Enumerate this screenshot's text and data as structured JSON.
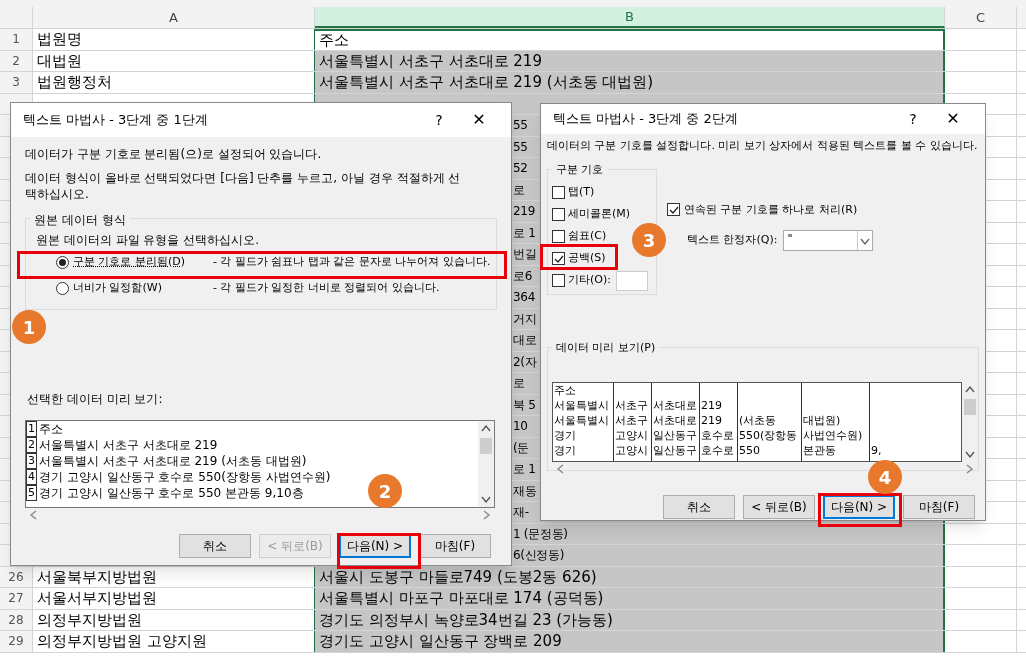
{
  "sheet": {
    "columns": [
      {
        "label": "A",
        "selected": false
      },
      {
        "label": "B",
        "selected": true
      },
      {
        "label": "C",
        "selected": false
      }
    ],
    "rows": [
      {
        "kind": "full",
        "num": "1",
        "a": "법원명",
        "b": "주소",
        "selected": false
      },
      {
        "kind": "full",
        "num": "2",
        "a": "대법원",
        "b": "서울특별시 서초구 서초대로 219",
        "selected": true
      },
      {
        "kind": "full",
        "num": "3",
        "a": "법원행정처",
        "b": "서울특별시 서초구 서초대로 219 (서초동 대법원)",
        "selected": true
      },
      {
        "kind": "covered",
        "selected": true
      },
      {
        "kind": "fragment",
        "b": "55",
        "selected": true
      },
      {
        "kind": "fragment",
        "b": "55",
        "selected": true
      },
      {
        "kind": "fragment",
        "b": "52",
        "selected": true
      },
      {
        "kind": "fragment",
        "b": "로 ",
        "selected": true
      },
      {
        "kind": "fragment",
        "b": "219",
        "selected": true
      },
      {
        "kind": "fragment",
        "b": "로 1",
        "selected": true
      },
      {
        "kind": "fragment",
        "b": "번길",
        "selected": true
      },
      {
        "kind": "fragment",
        "b": "로6",
        "selected": true
      },
      {
        "kind": "fragment",
        "b": "364",
        "selected": true
      },
      {
        "kind": "fragment",
        "b": "거지",
        "selected": true
      },
      {
        "kind": "fragment",
        "b": "대로",
        "selected": true
      },
      {
        "kind": "fragment",
        "b": "2(자",
        "selected": true
      },
      {
        "kind": "fragment",
        "b": "로 ",
        "selected": true
      },
      {
        "kind": "fragment",
        "b": "북 5",
        "selected": true
      },
      {
        "kind": "fragment",
        "b": " 10",
        "selected": true
      },
      {
        "kind": "fragment",
        "b": "(둔",
        "selected": true
      },
      {
        "kind": "fragment",
        "b": "로 1",
        "selected": true
      },
      {
        "kind": "fragment",
        "b": "재동",
        "selected": true
      },
      {
        "kind": "fragment",
        "b": "재-",
        "selected": true
      },
      {
        "kind": "fragment",
        "b": "1 (문정동)",
        "selected": true
      },
      {
        "kind": "fragment",
        "b": "6(신정동)",
        "selected": true
      },
      {
        "kind": "full",
        "num": "26",
        "a": "서울북부지방법원",
        "b": "서울시 도봉구 마들로749 (도봉2동 626)",
        "selected": true
      },
      {
        "kind": "full",
        "num": "27",
        "a": "서울서부지방법원",
        "b": "서울특별시 마포구 마포대로 174 (공덕동)",
        "selected": true
      },
      {
        "kind": "full",
        "num": "28",
        "a": "의정부지방법원",
        "b": "경기도 의정부시 녹양로34번길 23 (가능동)",
        "selected": true
      },
      {
        "kind": "full",
        "num": "29",
        "a": "의정부지방법원 고양지원",
        "b": "경기도 고양시 일산동구 장백로 209",
        "selected": true
      }
    ]
  },
  "wizard_step1": {
    "title": "텍스트 마법사 - 3단계 중 1단계",
    "help": "?",
    "close": "✕",
    "intro": "데이터가 구분 기호로 분리됨(으)로 설정되어 있습니다.",
    "instructions": "데이터 형식이 올바로 선택되었다면 [다음] 단추를 누르고, 아닐 경우 적절하게 선택하십시오.",
    "group_label": "원본 데이터 형식",
    "group_prompt": "원본 데이터의 파일 유형을 선택하십시오.",
    "options": [
      {
        "label": "구분 기호로 분리됨(D)",
        "description": "- 각 필드가 쉼표나 탭과 같은 문자로 나누어져 있습니다.",
        "selected": true
      },
      {
        "label": "너비가 일정함(W)",
        "description": "- 각 필드가 일정한 너비로 정렬되어 있습니다.",
        "selected": false
      }
    ],
    "preview_label": "선택한 데이터 미리 보기:",
    "preview_lines": [
      {
        "num": "1",
        "text": "주소"
      },
      {
        "num": "2",
        "text": "서울특별시 서초구 서초대로 219"
      },
      {
        "num": "3",
        "text": "서울특별시 서초구 서초대로 219 (서초동 대법원)"
      },
      {
        "num": "4",
        "text": "경기 고양시 일산동구 호수로 550(장항동 사법연수원)"
      },
      {
        "num": "5",
        "text": "경기 고양시 일산동구 호수로 550 본관동 9,10층"
      }
    ],
    "buttons": [
      {
        "label": "취소",
        "disabled": false,
        "focused": false
      },
      {
        "label": "< 뒤로(B)",
        "disabled": true,
        "focused": false
      },
      {
        "label": "다음(N) >",
        "disabled": false,
        "focused": true
      },
      {
        "label": "마침(F)",
        "disabled": false,
        "focused": false
      }
    ]
  },
  "wizard_step2": {
    "title": "텍스트 마법사 - 3단계 중 2단계",
    "help": "?",
    "close": "✕",
    "intro": "데이터의 구분 기호를 설정합니다. 미리 보기 상자에서 적용된 텍스트를 볼 수 있습니다.",
    "delimiter_label": "구분 기호",
    "delimiters": [
      {
        "label": "탭(T)",
        "checked": false
      },
      {
        "label": "세미콜론(M)",
        "checked": false
      },
      {
        "label": "쉼표(C)",
        "checked": false
      },
      {
        "label": "공백(S)",
        "checked": true
      },
      {
        "label": "기타(O):",
        "checked": false
      }
    ],
    "consecutive": {
      "label": "연속된 구분 기호를 하나로 처리(R)",
      "checked": true
    },
    "qualifier_label": "텍스트 한정자(Q):",
    "qualifier_value": "\"",
    "preview_label": "데이터 미리 보기(P)",
    "preview_rows": [
      [
        "주소"
      ],
      [
        "서울특별시",
        "서초구",
        "서초대로",
        "219"
      ],
      [
        "서울특별시",
        "서초구",
        "서초대로",
        "219",
        "(서초동",
        "대법원)"
      ],
      [
        "경기",
        "고양시",
        "일산동구",
        "호수로",
        "550(장항동",
        "사법연수원)"
      ],
      [
        "경기",
        "고양시",
        "일산동구",
        "호수로",
        "550",
        "본관동",
        "9,"
      ]
    ],
    "buttons": [
      {
        "label": "취소",
        "disabled": false,
        "focused": false
      },
      {
        "label": "< 뒤로(B)",
        "disabled": false,
        "focused": false
      },
      {
        "label": "다음(N) >",
        "disabled": false,
        "focused": true
      },
      {
        "label": "마침(F)",
        "disabled": false,
        "focused": false
      }
    ]
  },
  "annotations": [
    {
      "number": "1"
    },
    {
      "number": "2"
    },
    {
      "number": "3"
    },
    {
      "number": "4"
    }
  ]
}
